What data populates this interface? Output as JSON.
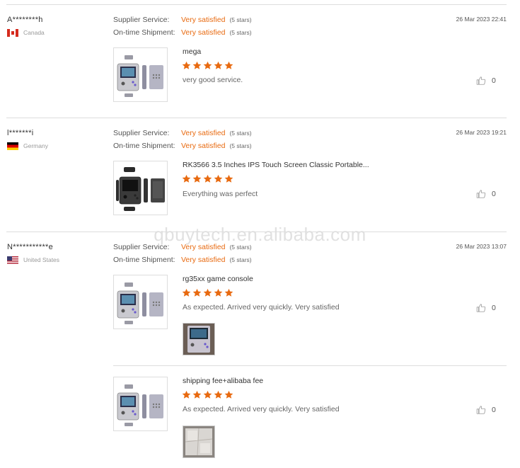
{
  "labels": {
    "supplier_service": "Supplier Service:",
    "ontime_shipment": "On-time Shipment:"
  },
  "watermark": "qbuytech.en.alibaba.com",
  "colors": {
    "accent": "#e86a10",
    "star": "#e86a10",
    "divider": "#dddddd"
  },
  "reviews": [
    {
      "name": "A********h",
      "country": "Canada",
      "flag": "canada-flag",
      "supplier_value": "Very satisfied",
      "supplier_stars": "(5 stars)",
      "shipment_value": "Very satisfied",
      "shipment_stars": "(5 stars)",
      "date": "26 Mar 2023 22:41",
      "items": [
        {
          "title": "mega",
          "rating": 5,
          "comment": "very good service.",
          "likes": "0"
        }
      ]
    },
    {
      "name": "l*******i",
      "country": "Germany",
      "flag": "germany-flag",
      "supplier_value": "Very satisfied",
      "supplier_stars": "(5 stars)",
      "shipment_value": "Very satisfied",
      "shipment_stars": "(5 stars)",
      "date": "26 Mar 2023 19:21",
      "items": [
        {
          "title": "RK3566 3.5 Inches IPS Touch Screen Classic Portable...",
          "rating": 5,
          "comment": "Everything was perfect",
          "likes": "0"
        }
      ]
    },
    {
      "name": "N***********e",
      "country": "United States",
      "flag": "usa-flag",
      "supplier_value": "Very satisfied",
      "supplier_stars": "(5 stars)",
      "shipment_value": "Very satisfied",
      "shipment_stars": "(5 stars)",
      "date": "26 Mar 2023 13:07",
      "items": [
        {
          "title": "rg35xx game console",
          "rating": 5,
          "comment": "As expected. Arrived very quickly. Very satisfied",
          "likes": "0"
        },
        {
          "title": "shipping fee+alibaba fee",
          "rating": 5,
          "comment": "As expected. Arrived very quickly. Very satisfied",
          "likes": "0"
        }
      ]
    }
  ]
}
